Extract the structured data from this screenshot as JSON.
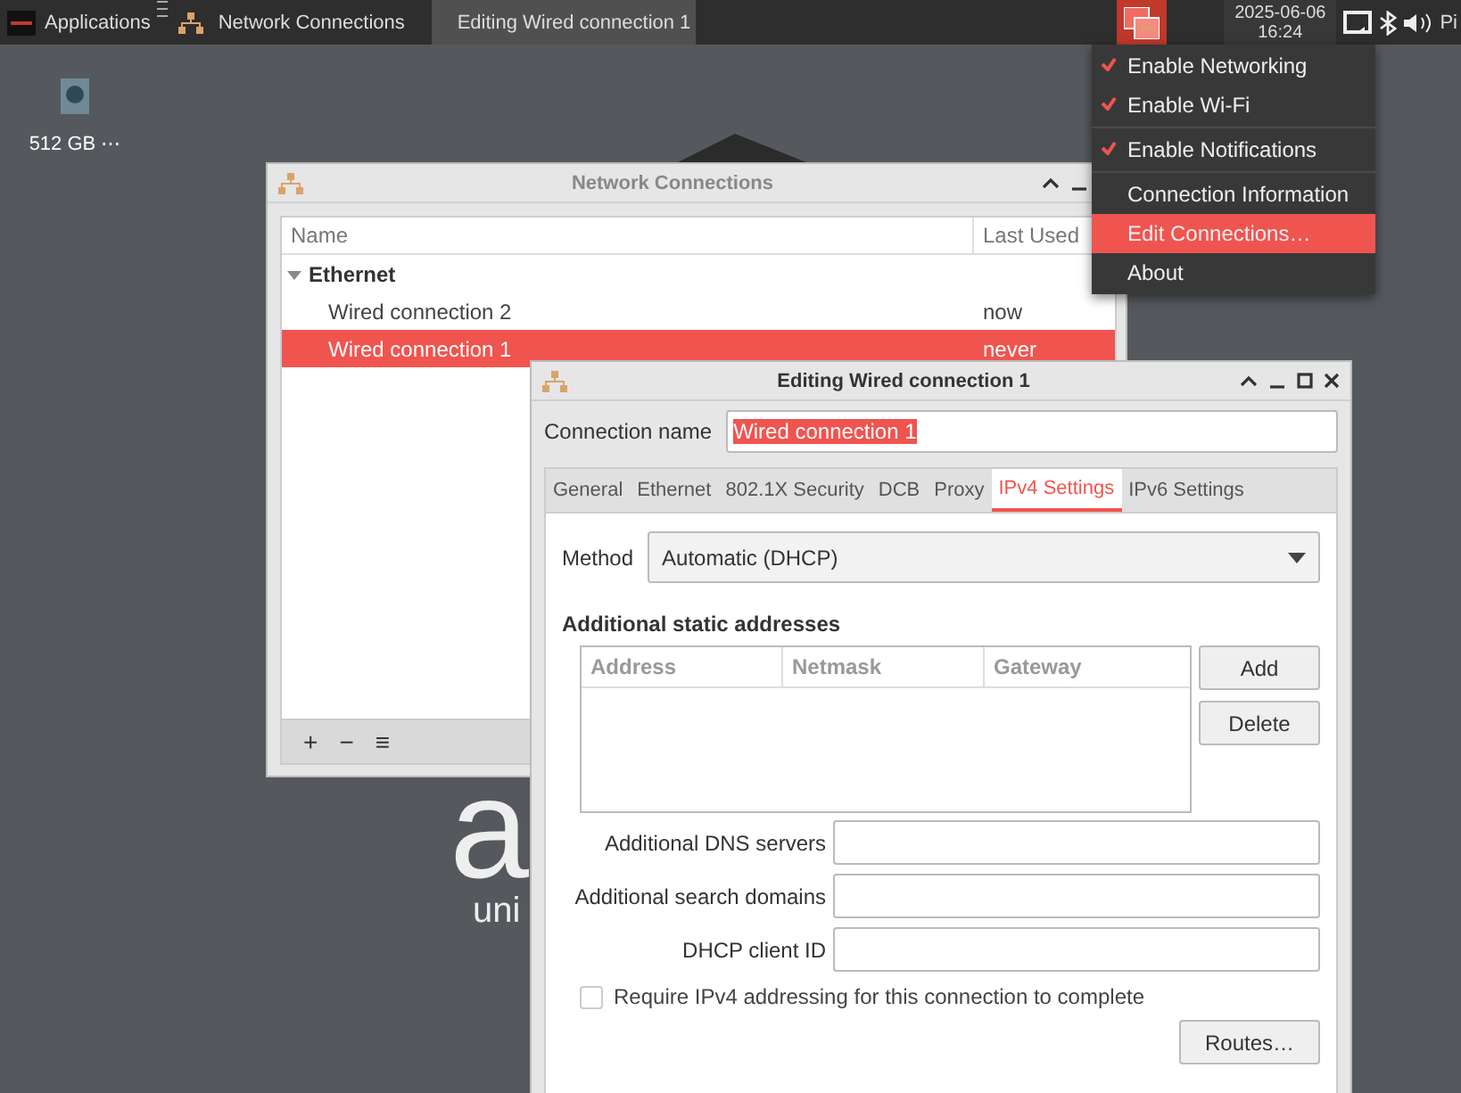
{
  "taskbar": {
    "app_menu": "Applications",
    "tasks": [
      {
        "label": "Network Connections",
        "selected": false
      },
      {
        "label": "Editing Wired connection 1",
        "selected": true
      }
    ],
    "network_tray_active": true,
    "clock_date": "2025-06-06",
    "clock_time": "16:24",
    "user": "Pi"
  },
  "desktop": {
    "icons": [
      {
        "label": "512 GB ⋯"
      }
    ],
    "wallpaper": {
      "logo": "a",
      "tagline": "uni"
    }
  },
  "tray_menu": {
    "items": [
      {
        "kind": "check",
        "label": "Enable Networking",
        "checked": true,
        "selected": false
      },
      {
        "kind": "check",
        "label": "Enable Wi-Fi",
        "checked": true,
        "selected": false
      },
      {
        "kind": "separator"
      },
      {
        "kind": "check",
        "label": "Enable Notifications",
        "checked": true,
        "selected": false
      },
      {
        "kind": "separator"
      },
      {
        "kind": "action",
        "label": "Connection Information",
        "selected": false
      },
      {
        "kind": "action",
        "label": "Edit Connections…",
        "selected": true
      },
      {
        "kind": "action",
        "label": "About",
        "selected": false
      }
    ]
  },
  "connections_window": {
    "title": "Network Connections",
    "columns": [
      "Name",
      "Last Used"
    ],
    "groups": [
      {
        "label": "Ethernet",
        "expanded": true,
        "children": [
          {
            "name": "Wired connection 2",
            "last_used": "now",
            "selected": false
          },
          {
            "name": "Wired connection 1",
            "last_used": "never",
            "selected": true
          }
        ]
      }
    ],
    "toolbar": [
      "+",
      "−",
      "≡"
    ]
  },
  "editor": {
    "title": "Editing Wired connection 1",
    "connection_name_label": "Connection name",
    "connection_name": "Wired connection 1",
    "name_text_selected": true,
    "tabs": [
      {
        "label": "General",
        "selected": false
      },
      {
        "label": "Ethernet",
        "selected": false
      },
      {
        "label": "802.1X Security",
        "selected": false
      },
      {
        "label": "DCB",
        "selected": false
      },
      {
        "label": "Proxy",
        "selected": false
      },
      {
        "label": "IPv4 Settings",
        "selected": true
      },
      {
        "label": "IPv6 Settings",
        "selected": false
      }
    ],
    "method_label": "Method",
    "method": "Automatic (DHCP)",
    "addresses_heading": "Additional static addresses",
    "address_columns": [
      "Address",
      "Netmask",
      "Gateway"
    ],
    "address_buttons": [
      "Add",
      "Delete"
    ],
    "fields": [
      {
        "label": "Additional DNS servers"
      },
      {
        "label": "Additional search domains"
      },
      {
        "label": "DHCP client ID"
      }
    ],
    "require_checkbox": {
      "label": "Require IPv4 addressing for this connection to complete",
      "checked": false
    },
    "routes_button": "Routes…"
  }
}
